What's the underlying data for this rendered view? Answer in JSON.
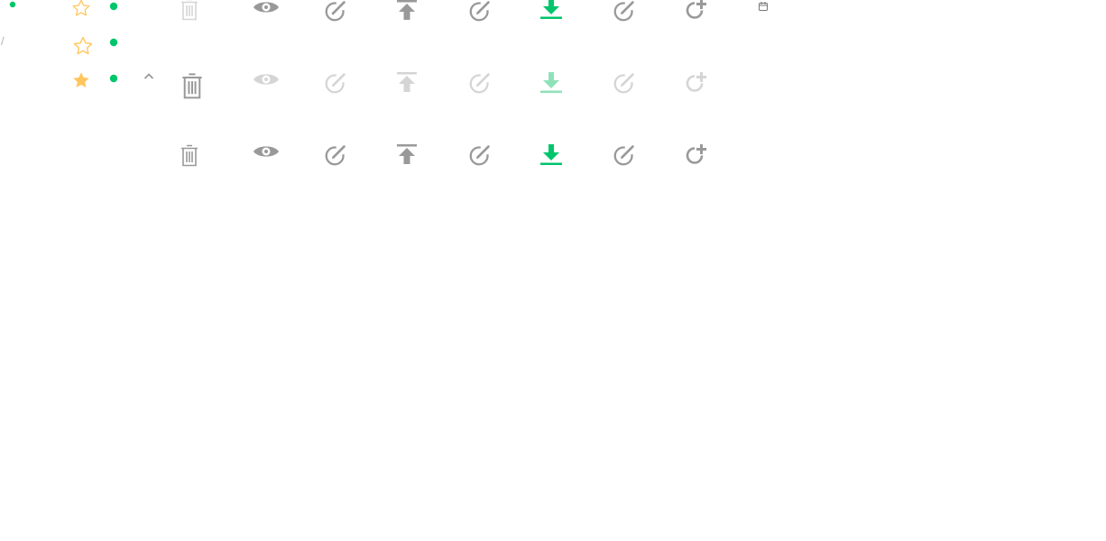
{
  "separator_glyph": "/",
  "colors": {
    "gray": "#999999",
    "light_gray": "#d5d5d5",
    "green": "#00c56b",
    "light_green": "#8fe2b8",
    "star": "#ffc65c",
    "sprite_gray": "#777777"
  },
  "icons": {
    "row1": [
      "green-dot",
      "star-outline",
      "green-dot",
      "trash",
      "eye",
      "edit",
      "upload",
      "edit",
      "download",
      "edit",
      "add-circle",
      "small-calendar"
    ],
    "row2": [
      "separator",
      "star-outline",
      "green-dot"
    ],
    "row3": [
      "star-filled",
      "green-dot",
      "caret-up",
      "trash-large",
      "eye",
      "edit",
      "upload",
      "edit",
      "download",
      "edit",
      "add-circle"
    ],
    "row4": [
      "trash",
      "eye",
      "edit",
      "upload",
      "edit",
      "download",
      "edit",
      "add-circle"
    ]
  }
}
